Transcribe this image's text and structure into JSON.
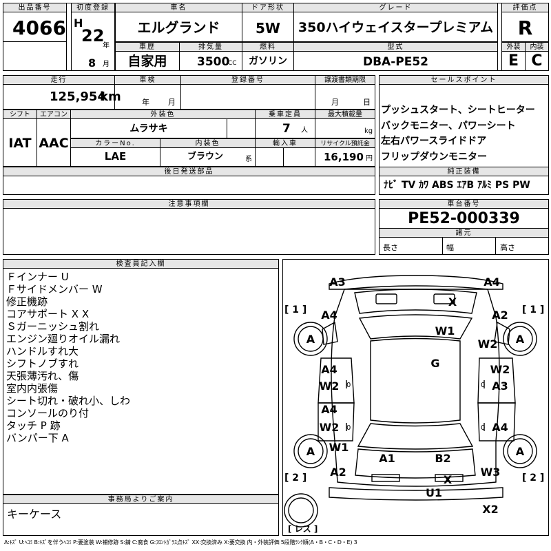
{
  "header": {
    "lot_no_label": "出品番号",
    "lot_no": "4066",
    "first_reg_label": "初度登録",
    "era": "H",
    "year": "22",
    "year_unit": "年",
    "month": "8",
    "month_unit": "月",
    "car_name_label": "車名",
    "car_name": "エルグランド",
    "door_label": "ドア形状",
    "door": "5W",
    "grade_label": "グレード",
    "grade": "350ハイウェイスタープレミアム",
    "score_label": "評価点",
    "score": "R",
    "history_label": "車歴",
    "history": "自家用",
    "displacement_label": "排気量",
    "displacement": "3500",
    "displacement_unit": "CC",
    "fuel_label": "燃料",
    "fuel": "ガソリン",
    "model_label": "型式",
    "model": "DBA-PE52",
    "exterior_label": "外装",
    "exterior": "E",
    "interior_label": "内装",
    "interior": "C"
  },
  "row2": {
    "mileage_label": "走行",
    "mileage": "125,954",
    "mileage_unit": "km",
    "inspection_label": "車検",
    "insp_year_unit": "年",
    "insp_month_unit": "月",
    "plate_label": "登録番号",
    "transfer_label": "譲渡書類期限",
    "transfer_month_unit": "月",
    "transfer_day_unit": "日",
    "shift_label": "シフト",
    "shift": "IAT",
    "ac_label": "エアコン",
    "ac": "AAC",
    "color_label": "外装色",
    "color": "ムラサキ",
    "capacity_label": "乗車定員",
    "capacity": "7",
    "capacity_unit": "人",
    "loadcap_label": "最大積載量",
    "loadcap_unit": "kg",
    "color_no_label": "カラーNo.",
    "color_no": "LAE",
    "int_color_label": "内装色",
    "int_color": "ブラウン",
    "int_color_suffix": "系",
    "import_label": "輸入車",
    "recycle_label": "リサイクル預託金",
    "recycle": "16,190",
    "recycle_unit": "円",
    "later_parts_label": "後日発送部品"
  },
  "sales": {
    "label": "セールスポイント",
    "lines": [
      "プッシュスタート、シートヒーター",
      "バックモニター、パワーシート",
      "左右パワースライドドア",
      "フリップダウンモニター"
    ]
  },
  "equipment": {
    "label": "純正装備",
    "items": [
      "ﾅﾋﾞ",
      "TV",
      "ｶﾜ",
      "ABS",
      "ｴｱB",
      "ｱﾙﾐ",
      "PS",
      "PW"
    ]
  },
  "caution_label": "注意事項欄",
  "chassis": {
    "label": "車台番号",
    "number": "PE52-000339",
    "dims_label": "諸元",
    "length_label": "長さ",
    "width_label": "幅",
    "height_label": "高さ"
  },
  "inspector": {
    "label": "検査員記入欄",
    "lines": [
      "Ｆインナー U",
      "Ｆサイドメンバー W",
      "修正機跡",
      "コアサポート X X",
      "Ｓガーニッシュ割れ",
      "エンジン廻りオイル漏れ",
      "ハンドルすれ大",
      "シフトノブすれ",
      "天張薄汚れ、傷",
      "室内内張傷",
      "シート切れ・破れ小、しわ",
      "コンソールのり付",
      "タッチ P 跡",
      "バンパー下 A"
    ]
  },
  "office": {
    "label": "事務局よりご案内",
    "text": "キーケース"
  },
  "diagram": {
    "marks": [
      "A3",
      "A4",
      "X",
      "A4",
      "A2",
      "W1",
      "A",
      "A",
      "W2",
      "G",
      "A4",
      "W2",
      "W2",
      "A3",
      "A4",
      "W2",
      "A4",
      "A",
      "W1",
      "A",
      "A1",
      "B2",
      "A2",
      "W3",
      "X",
      "U1",
      "X2"
    ],
    "left_front": "[ 1 ]",
    "right_front": "[ 1 ]",
    "left_rear": "[ 2 ]",
    "right_rear": "[ 2 ]",
    "spare": "[ レス ]"
  },
  "legend": "A:ｷｽﾞ U:ﾍｺﾐ B:ｷｽﾞを伴うﾍｺﾐ P:要塗装 W:補修跡 S:錆 C:腐食 G:ﾌﾛﾝﾄｶﾞﾗｽ点ｷｽﾞ XX:交換済み X:要交換 内・外装評価 5段階ﾗﾝｸ順(A・B・C・D・E) 3"
}
